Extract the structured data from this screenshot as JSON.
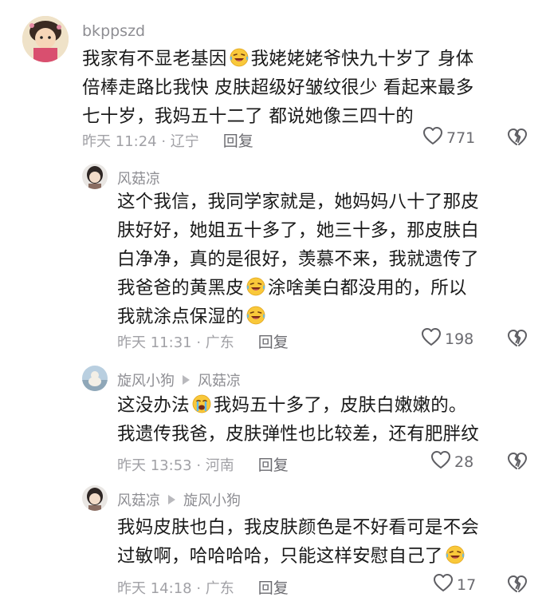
{
  "comments": [
    {
      "user": "bkppszd",
      "lines": [
        [
          "我家有不显老基因",
          "laugh",
          "我姥姥姥爷快九十岁了 身体"
        ],
        [
          "倍棒走路比我快 皮肤超级好皱纹很少  看起来最多"
        ],
        [
          "七十岁，我妈五十二了 都说她像三四十的"
        ]
      ],
      "time": "昨天 11:24 · 辽宁",
      "reply": "回复",
      "likes": "771"
    },
    {
      "user": "风菇凉",
      "lines": [
        [
          "这个我信，我同学家就是，她妈妈八十了那皮"
        ],
        [
          "肤好好，她姐五十多了，她三十多，那皮肤白"
        ],
        [
          "白净净，真的是很好，羡慕不来，我就遗传了"
        ],
        [
          "我爸爸的黄黑皮",
          "laugh",
          "涂啥美白都没用的，所以"
        ],
        [
          "我就涂点保湿的",
          "laugh",
          ""
        ]
      ],
      "time": "昨天 11:31 · 广东",
      "reply": "回复",
      "likes": "198"
    },
    {
      "user": "旋风小狗",
      "reply_to": "风菇凉",
      "lines": [
        [
          "这没办法",
          "cry",
          "我妈五十多了，皮肤白嫩嫩的。"
        ],
        [
          "我遗传我爸，皮肤弹性也比较差，还有肥胖纹"
        ]
      ],
      "time": "昨天 13:53 · 河南",
      "reply": "回复",
      "likes": "28"
    },
    {
      "user": "风菇凉",
      "reply_to": "旋风小狗",
      "lines": [
        [
          "我妈皮肤也白，我皮肤颜色是不好看可是不会"
        ],
        [
          "过敏啊，哈哈哈哈，只能这样安慰自己了",
          "laugh",
          ""
        ]
      ],
      "time": "昨天 14:18 · 广东",
      "reply": "回复",
      "likes": "17"
    }
  ],
  "icons": {
    "like": "heart-outline-icon",
    "dislike": "broken-heart-icon",
    "laugh": "laughing-tears-emoji",
    "cry": "crying-emoji"
  },
  "colors": {
    "text": "#1a1a1a",
    "username": "#8e8e93",
    "meta": "#a1a1a6",
    "emoji": "#f9c83a"
  }
}
